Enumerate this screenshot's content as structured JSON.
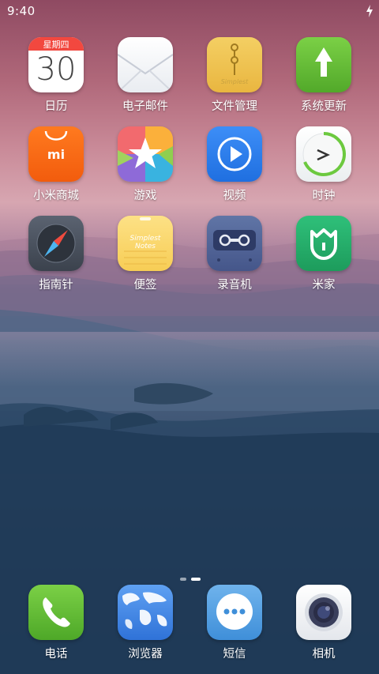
{
  "status_bar": {
    "time": "9:40"
  },
  "apps": [
    {
      "label": "日历",
      "icon": "calendar-icon",
      "weekday": "星期四",
      "day": "30"
    },
    {
      "label": "电子邮件",
      "icon": "email-envelope-icon"
    },
    {
      "label": "文件管理",
      "icon": "file-manager-folder-icon",
      "icon_text": "Simplest"
    },
    {
      "label": "系统更新",
      "icon": "system-update-arrow-icon"
    },
    {
      "label": "小米商城",
      "icon": "mi-store-bag-icon",
      "icon_text": "mi"
    },
    {
      "label": "游戏",
      "icon": "games-star-icon"
    },
    {
      "label": "视频",
      "icon": "video-play-icon"
    },
    {
      "label": "时钟",
      "icon": "clock-icon"
    },
    {
      "label": "指南针",
      "icon": "compass-icon"
    },
    {
      "label": "便签",
      "icon": "notes-icon",
      "icon_text": "Simplest Notes"
    },
    {
      "label": "录音机",
      "icon": "recorder-cassette-icon"
    },
    {
      "label": "米家",
      "icon": "mijia-home-icon"
    }
  ],
  "dock": [
    {
      "label": "电话",
      "icon": "phone-icon"
    },
    {
      "label": "浏览器",
      "icon": "browser-globe-icon"
    },
    {
      "label": "短信",
      "icon": "messages-bubble-icon"
    },
    {
      "label": "相机",
      "icon": "camera-icon"
    }
  ],
  "page_indicator": {
    "pages": 2,
    "current": 2
  }
}
